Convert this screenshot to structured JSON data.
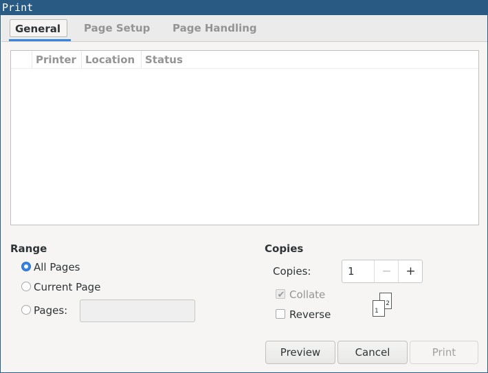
{
  "window": {
    "title": "Print"
  },
  "tabs": [
    {
      "label": "General",
      "active": true
    },
    {
      "label": "Page Setup",
      "active": false
    },
    {
      "label": "Page Handling",
      "active": false
    }
  ],
  "printer_list": {
    "columns": [
      "Printer",
      "Location",
      "Status"
    ],
    "rows": []
  },
  "range": {
    "title": "Range",
    "options": [
      {
        "label": "All Pages",
        "checked": true
      },
      {
        "label": "Current Page",
        "checked": false
      },
      {
        "label": "Pages:",
        "checked": false
      }
    ],
    "pages_value": ""
  },
  "copies": {
    "title": "Copies",
    "label": "Copies:",
    "value": "1",
    "minus_symbol": "−",
    "plus_symbol": "+",
    "collate": {
      "label": "Collate",
      "checked": true,
      "enabled": false
    },
    "reverse": {
      "label": "Reverse",
      "checked": false,
      "enabled": true
    },
    "illustration": {
      "back_page": "2",
      "front_page": "1"
    }
  },
  "buttons": {
    "preview": "Preview",
    "cancel": "Cancel",
    "print": "Print"
  },
  "colors": {
    "titlebar": "#285a84",
    "accent": "#3584e4"
  }
}
